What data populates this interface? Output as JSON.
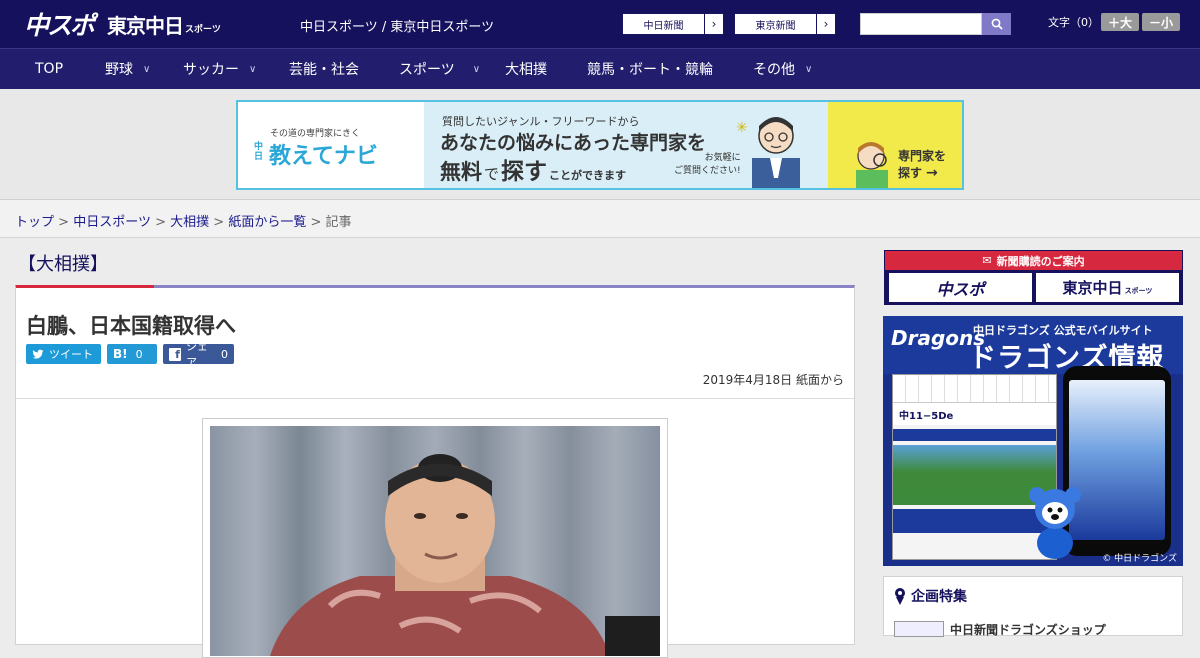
{
  "header": {
    "logo_primary": "中スポ",
    "logo_secondary": "東京中日",
    "logo_secondary_small": "スポーツ",
    "site_links": "中日スポーツ / 東京中日スポーツ",
    "paper_buttons": [
      {
        "label": "中日新聞"
      },
      {
        "label": "東京新聞"
      }
    ],
    "search_placeholder": "",
    "font_size_label": "文字（0）",
    "font_larger": "＋大",
    "font_smaller": "－小"
  },
  "nav": {
    "items": [
      {
        "label": "TOP",
        "dropdown": false
      },
      {
        "label": "野球",
        "dropdown": true
      },
      {
        "label": "サッカー",
        "dropdown": true
      },
      {
        "label": "芸能・社会",
        "dropdown": false
      },
      {
        "label": "スポーツ",
        "dropdown": true
      },
      {
        "label": "大相撲",
        "dropdown": false
      },
      {
        "label": "競馬・ボート・競輪",
        "dropdown": false
      },
      {
        "label": "その他",
        "dropdown": true
      }
    ]
  },
  "ad_banner": {
    "brand_small": "その道の専門家にきく",
    "brand_prefix": "中日",
    "brand_name": "教えてナビ",
    "line1": "質問したいジャンル・フリーワードから",
    "line2": "あなたの悩みにあった専門家を",
    "line3_a": "無料",
    "line3_b": "で",
    "line3_c": "探す",
    "line3_d": "ことができます",
    "aside": "お気軽に\nご質問ください!",
    "cta_line1": "専門家を",
    "cta_line2": "探す",
    "colors": {
      "border": "#56c1e0",
      "cta_bg": "#f2e94a",
      "mid_bg": "#d9eef6"
    }
  },
  "breadcrumb": {
    "items": [
      "トップ",
      "中日スポーツ",
      "大相撲",
      "紙面から一覧"
    ],
    "current": "記事",
    "separator": ">"
  },
  "article": {
    "category": "【大相撲】",
    "title": "白鵬、日本国籍取得へ",
    "share": {
      "tweet_label": "ツイート",
      "hatena_label": "B!",
      "hatena_count": "0",
      "facebook_label": "シェア",
      "facebook_count": "0"
    },
    "date": "2019年4月18日 紙面から"
  },
  "sidebar": {
    "subscribe_title": "新聞購読のご案内",
    "subscribe_buttons": [
      "中スポ",
      "東京中日"
    ],
    "subscribe_small": "スポーツ",
    "dragons_ad": {
      "brand": "Dragons",
      "subtitle": "中日ドラゴンズ 公式モバイルサイト",
      "title": "ドラゴンズ情報",
      "score": "中11−5De",
      "footer": "© 中日ドラゴンズ"
    },
    "feature_title": "企画特集",
    "feature_item": "中日新聞ドラゴンズショップ"
  },
  "colors": {
    "header_bg": "#15115c",
    "nav_bg": "#221e6d",
    "accent_red": "#d6283f",
    "twitter": "#1d9bd8",
    "hatena": "#2399d6",
    "facebook": "#3b5998"
  }
}
